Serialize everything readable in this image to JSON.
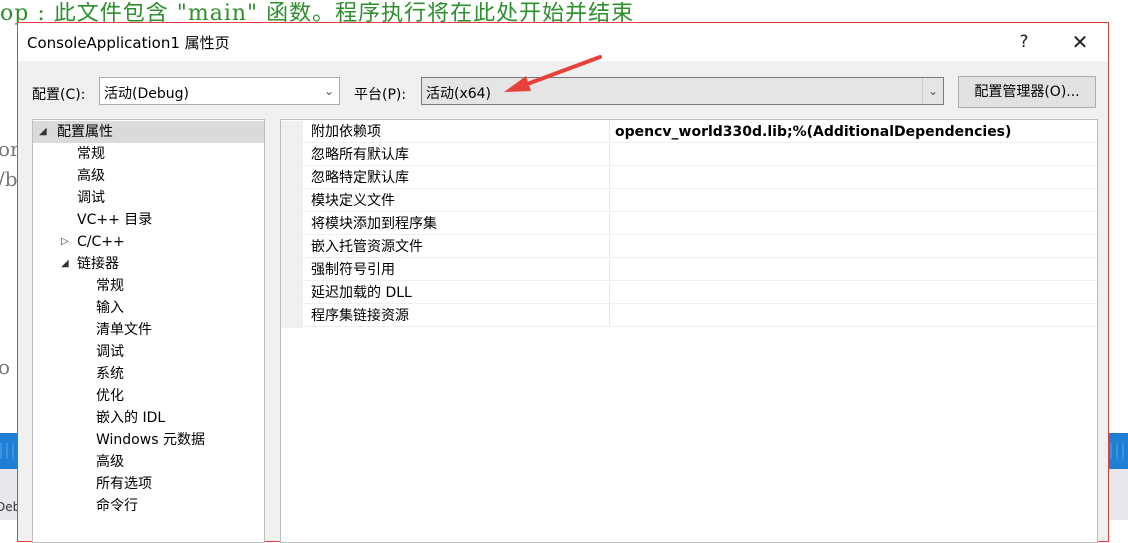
{
  "background": {
    "code_line": "op : 此文件包含 \"main\" 函数。程序执行将在此处开始并结束",
    "frag_1": "or",
    "frag_2": "/b",
    "frag_3": "o",
    "bottom_frag": "Deb"
  },
  "dialog": {
    "title": "ConsoleApplication1 属性页",
    "help_label": "?",
    "close_label": "✕"
  },
  "config_row": {
    "config_label": "配置(C):",
    "config_value": "活动(Debug)",
    "platform_label": "平台(P):",
    "platform_value": "活动(x64)",
    "manager_button": "配置管理器(O)..."
  },
  "tree": {
    "items": [
      {
        "label": "配置属性",
        "arrow": "◢"
      },
      {
        "label": "常规"
      },
      {
        "label": "高级"
      },
      {
        "label": "调试"
      },
      {
        "label": "VC++ 目录"
      },
      {
        "label": "C/C++",
        "arrow": "▷"
      },
      {
        "label": "链接器",
        "arrow": "◢"
      },
      {
        "label": "常规"
      },
      {
        "label": "输入"
      },
      {
        "label": "清单文件"
      },
      {
        "label": "调试"
      },
      {
        "label": "系统"
      },
      {
        "label": "优化"
      },
      {
        "label": "嵌入的 IDL"
      },
      {
        "label": "Windows 元数据"
      },
      {
        "label": "高级"
      },
      {
        "label": "所有选项"
      },
      {
        "label": "命令行"
      }
    ]
  },
  "grid": {
    "rows": [
      {
        "name": "附加依赖项",
        "value": "opencv_world330d.lib;%(AdditionalDependencies)"
      },
      {
        "name": "忽略所有默认库",
        "value": ""
      },
      {
        "name": "忽略特定默认库",
        "value": ""
      },
      {
        "name": "模块定义文件",
        "value": ""
      },
      {
        "name": "将模块添加到程序集",
        "value": ""
      },
      {
        "name": "嵌入托管资源文件",
        "value": ""
      },
      {
        "name": "强制符号引用",
        "value": ""
      },
      {
        "name": "延迟加载的 DLL",
        "value": ""
      },
      {
        "name": "程序集链接资源",
        "value": ""
      }
    ]
  },
  "colors": {
    "dialog_border": "#e0413c",
    "annotation_arrow": "#e8403a",
    "code_comment": "#2d8f2d",
    "status_bar": "#1f7fd4"
  }
}
